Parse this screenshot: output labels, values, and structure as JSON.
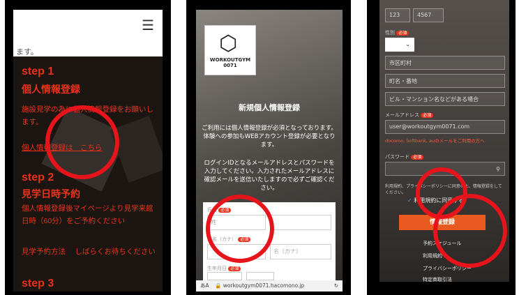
{
  "phone1": {
    "top_fragment": "ます。",
    "step1_title": "step 1",
    "step1_heading": "個人情報登録",
    "step1_text": "施設見学の為に個人情報登録をお願いします。",
    "step1_link": "個人情報登録は　こちら",
    "step2_title": "step 2",
    "step2_heading": "見学日時予約",
    "step2_text": "個人情報登録後マイページより見学来館日時（60分）をご予約ください",
    "step2_link": "見学予約方法　 しばらくお待ちください",
    "step3_title": "step 3"
  },
  "phone2": {
    "logo_text": "WORKOUTGYM 0071",
    "title": "新規個人情報登録",
    "para1": "ご利用には個人情報登録が必須となっております。体験への参加もWEBアカウント登録が必要となります。",
    "para2": "ログインIDとなるメールアドレスとパスワードを入力してください。入力されたメールアドレスに確認メールを送信いたしますので必ずご確認ください。",
    "name_label": "氏名",
    "required": "必須",
    "last_name_placeholder": "姓",
    "kana_label": "氏名（カナ）",
    "kana_first_placeholder": "名（カナ）",
    "birth_label": "生年月日",
    "url": "workoutgym0071.hacomono.jp"
  },
  "phone3": {
    "tel_parts": [
      "123",
      "4567"
    ],
    "gender_label": "性別",
    "required": "必須",
    "city_placeholder": "市区町村",
    "street_placeholder": "町名・番地",
    "building_placeholder": "ビル・マンション名などがある場合",
    "email_label": "メールアドレス",
    "email_value": "user@workoutgym0071.com",
    "email_note": "docomo, Softbank, auのメールをご利用の方へ",
    "password_label": "パスワード",
    "consent_text": "利用規約、プライバシーポリシーに同意の上、情報登録をしてください。",
    "agree_label": "利用規約に同意する",
    "submit_label": "情報登録",
    "footer_links": [
      "予約スケジュール",
      "利用規約",
      "プライバシーポリシー",
      "特定商取引法"
    ]
  }
}
